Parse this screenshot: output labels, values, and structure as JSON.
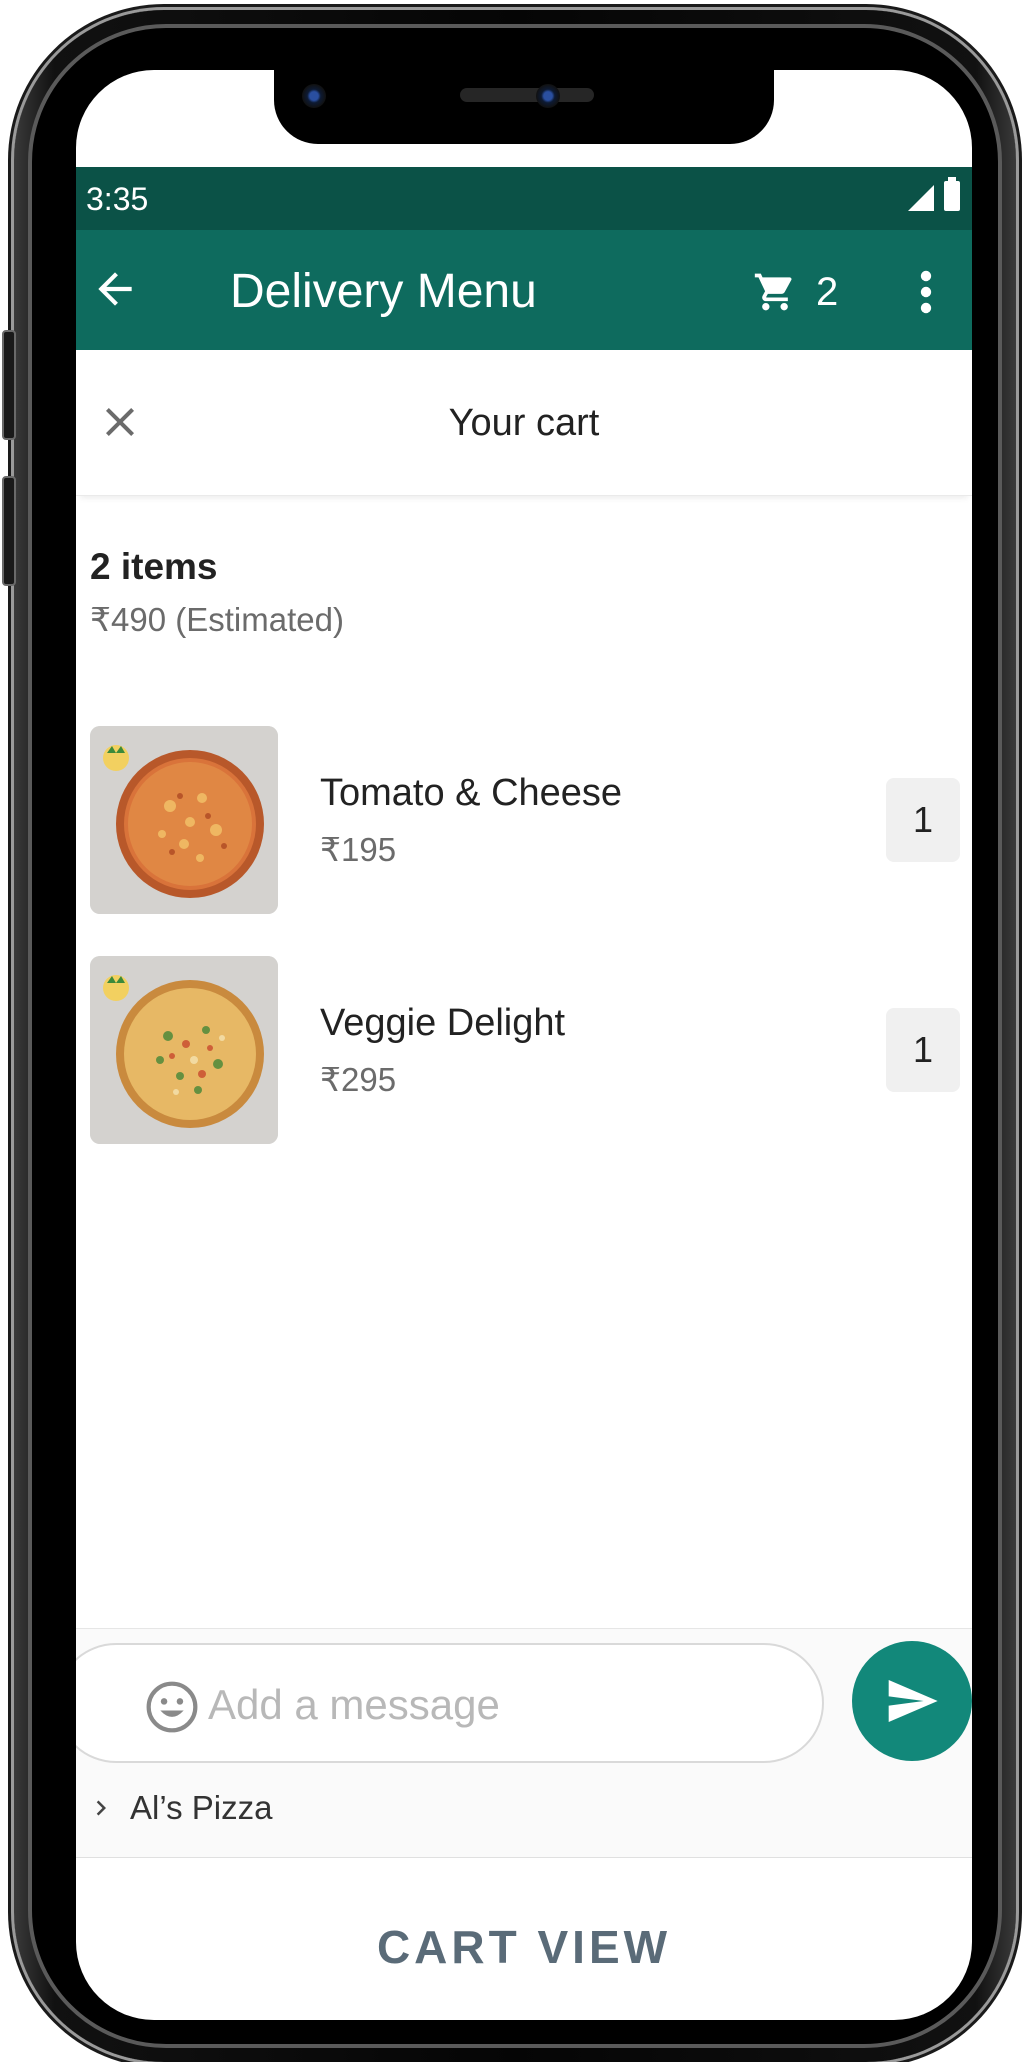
{
  "status_bar": {
    "time": "3:35"
  },
  "app_bar": {
    "title": "Delivery Menu",
    "cart_count": "2"
  },
  "cart_sheet": {
    "title": "Your cart",
    "item_count": "2 items",
    "estimated_total": "₹490 (Estimated)",
    "items": [
      {
        "name": "Tomato & Cheese",
        "price": "₹195",
        "quantity": "1"
      },
      {
        "name": "Veggie Delight",
        "price": "₹295",
        "quantity": "1"
      }
    ]
  },
  "composer": {
    "placeholder": "Add a message",
    "business_name": "Al’s Pizza"
  },
  "caption": "CART VIEW",
  "colors": {
    "status_bar": "#0b5247",
    "app_bar": "#0e6b5e",
    "send_button": "#12887a"
  },
  "icons": [
    "back-arrow-icon",
    "cart-icon",
    "more-vert-icon",
    "close-icon",
    "emoji-icon",
    "send-icon",
    "chevron-right-icon",
    "signal-icon",
    "battery-icon"
  ]
}
